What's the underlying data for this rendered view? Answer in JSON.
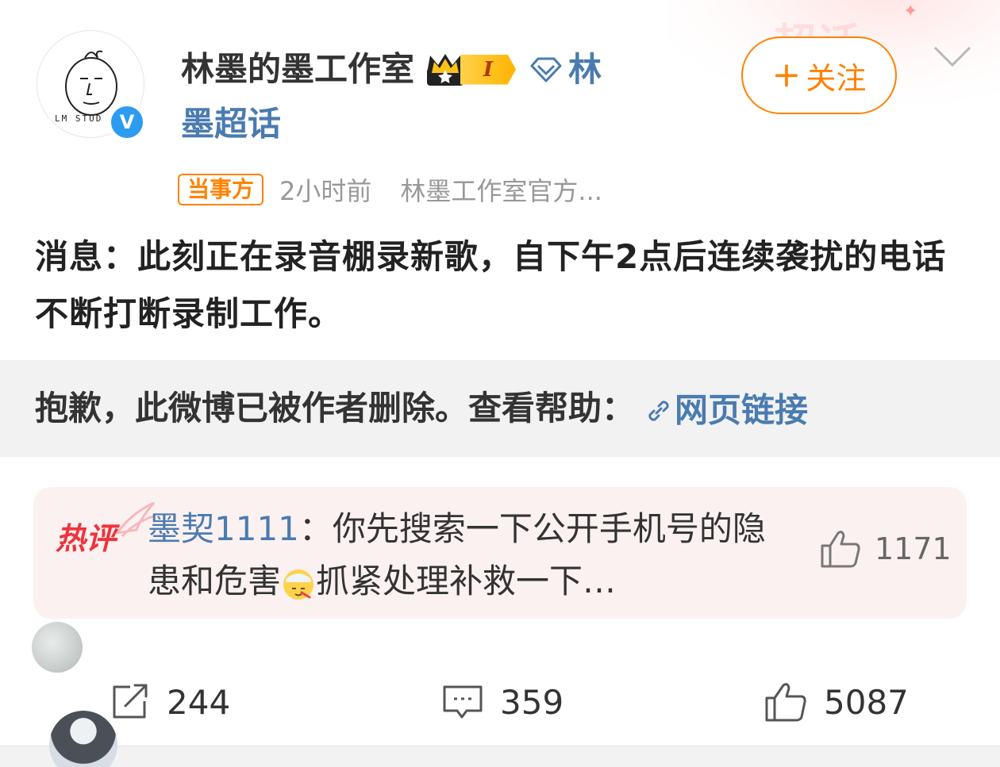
{
  "colors": {
    "accent_orange": "#ff8200",
    "link_blue": "#4a7bb0",
    "hot_red": "#f0323c",
    "verified_blue": "#2d9cf0",
    "deleted_bg": "#f2f2f2",
    "hot_comment_bg": "#fcf1f1"
  },
  "header_deco": {
    "text": "超话"
  },
  "author": {
    "avatar_logo_text": "LM STUD",
    "verified_mark": "V",
    "name": "林墨的墨工作室",
    "level_badge": "I",
    "supertopic_part1": "林",
    "supertopic_part2": "墨超话",
    "icons": [
      "crown-icon",
      "diamond-icon",
      "verified-icon"
    ]
  },
  "follow_button": {
    "plus": "+",
    "label": "关注"
  },
  "meta": {
    "badge": "当事方",
    "time": "2小时前",
    "source": "林墨工作室官方..."
  },
  "post": {
    "text": "消息：此刻正在录音棚录新歌，自下午2点后连续袭扰的电话不断打断录制工作。"
  },
  "deleted_notice": {
    "text": "抱歉，此微博已被作者删除。查看帮助：",
    "link_label": "网页链接",
    "link_icon": "link-icon"
  },
  "hot_comment": {
    "badge": "热评",
    "author": "墨契1111",
    "separator": "：",
    "text_part1": "你先搜索一下公开手机号的隐患和危害",
    "text_part2": "抓紧处理补救一下…",
    "emoji": "sick-face-icon",
    "likes": "1171"
  },
  "actions": {
    "reposts": "244",
    "comments": "359",
    "likes": "5087"
  }
}
